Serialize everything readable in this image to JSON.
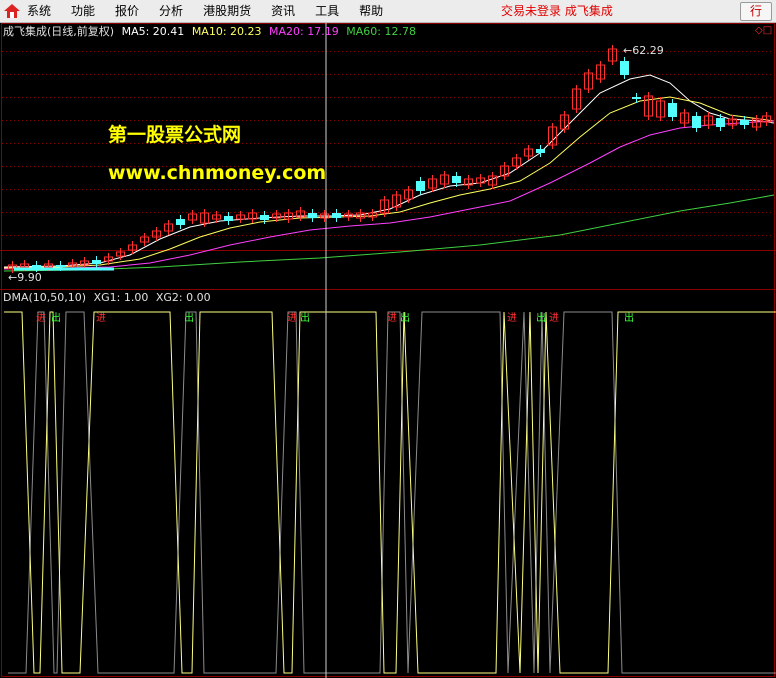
{
  "menubar": {
    "items": [
      "系统",
      "功能",
      "报价",
      "分析",
      "港股期货",
      "资讯",
      "工具",
      "帮助"
    ],
    "status_text": "交易未登录  成飞集成",
    "quote_button": "行"
  },
  "main_chart": {
    "title": "成飞集成(日线,前复权)",
    "ma5": "MA5: 20.41",
    "ma10": "MA10: 20.23",
    "ma20": "MA20: 17.19",
    "ma60": "MA60: 12.78",
    "high_label": "62.29",
    "low_label": "9.90",
    "corner_marker": "◇□"
  },
  "colors": {
    "ma5": "#ffffff",
    "ma10": "#ffff60",
    "ma20": "#ff40ff",
    "ma60": "#40d040",
    "up": "#ff3030",
    "down": "#54ffff",
    "grid": "#8a0000",
    "dma": "#ffff80",
    "buy": "#ff3030",
    "sell": "#40ff40"
  },
  "watermark": {
    "line1": "第一股票公式网",
    "line2": "www.chnmoney.com"
  },
  "sub_chart": {
    "title": "DMA(10,50,10)",
    "xg1": "XG1: 1.00",
    "xg2": "XG2: 0.00"
  },
  "signals": {
    "buy_label": "进",
    "sell_label": "出"
  }
}
